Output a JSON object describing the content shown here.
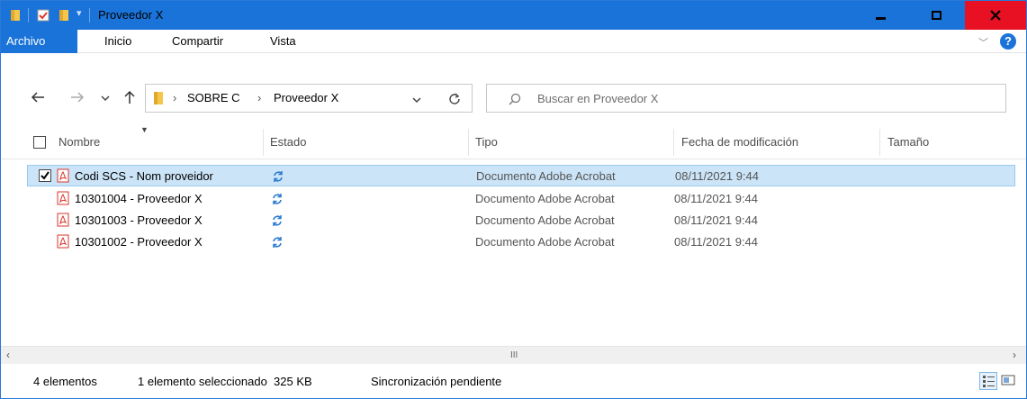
{
  "window": {
    "title": "Proveedor X",
    "accent": "#1a73d9",
    "close_color": "#e81123"
  },
  "ribbon": {
    "tabs": [
      "Archivo",
      "Inicio",
      "Compartir",
      "Vista"
    ]
  },
  "address": {
    "path": [
      "SOBRE C",
      "Proveedor X"
    ],
    "search_placeholder": "Buscar en Proveedor X"
  },
  "columns": [
    "Nombre",
    "Estado",
    "Tipo",
    "Fecha de modificación",
    "Tamaño"
  ],
  "files": [
    {
      "name": "Codi SCS - Nom proveidor",
      "type": "Documento Adobe Acrobat",
      "date": "08/11/2021 9:44",
      "selected": true,
      "status_icon": "sync-pending-icon"
    },
    {
      "name": "10301004 - Proveedor X",
      "type": "Documento Adobe Acrobat",
      "date": "08/11/2021 9:44",
      "selected": false,
      "status_icon": "sync-pending-icon"
    },
    {
      "name": "10301003 - Proveedor X",
      "type": "Documento Adobe Acrobat",
      "date": "08/11/2021 9:44",
      "selected": false,
      "status_icon": "sync-pending-icon"
    },
    {
      "name": "10301002 - Proveedor X",
      "type": "Documento Adobe Acrobat",
      "date": "08/11/2021 9:44",
      "selected": false,
      "status_icon": "sync-pending-icon"
    }
  ],
  "statusbar": {
    "count": "4 elementos",
    "selection": "1 elemento seleccionado  325 KB",
    "sync": "Sincronización pendiente"
  }
}
